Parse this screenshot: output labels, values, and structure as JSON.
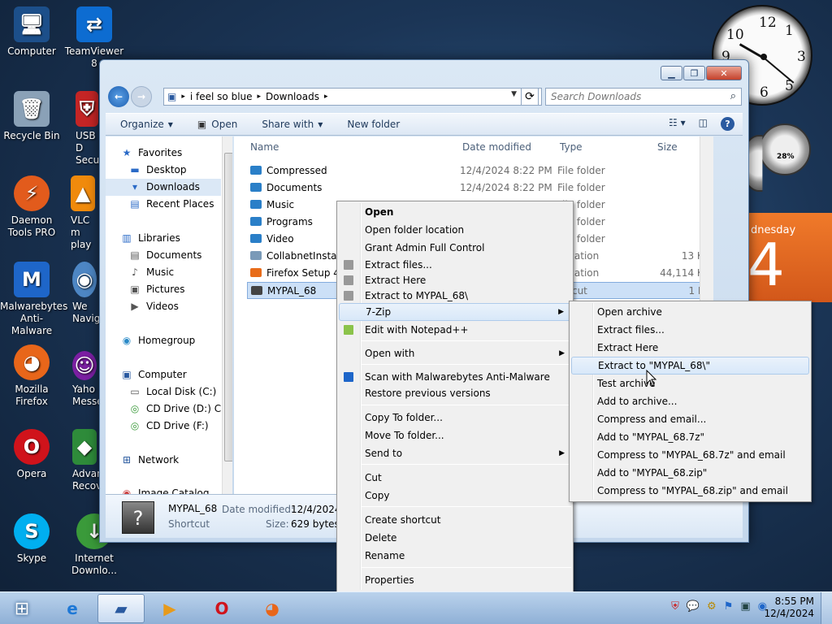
{
  "desktop": {
    "icons": [
      {
        "label": "Computer",
        "glyph": "🖥"
      },
      {
        "label": "TeamViewer 8",
        "glyph": "⇄"
      },
      {
        "label": "Recycle Bin",
        "glyph": "🗑"
      },
      {
        "label": "USB D Secu",
        "glyph": "⛨"
      },
      {
        "label": "Daemon Tools PRO",
        "glyph": "⚡"
      },
      {
        "label": "VLC m play",
        "glyph": "▲"
      },
      {
        "label": "Malwarebytes Anti-Malware",
        "glyph": "M"
      },
      {
        "label": "We Naviga",
        "glyph": "◉"
      },
      {
        "label": "Mozilla Firefox",
        "glyph": "◕"
      },
      {
        "label": "Yaho Messe",
        "glyph": "☺"
      },
      {
        "label": "Opera",
        "glyph": "O"
      },
      {
        "label": "Advanc Recov",
        "glyph": "◆"
      },
      {
        "label": "Skype",
        "glyph": "S"
      },
      {
        "label": "Internet Downlo...",
        "glyph": "↓"
      }
    ],
    "meter_label": "28%",
    "calendar_day": "dnesday",
    "calendar_date": "4"
  },
  "explorer": {
    "breadcrumbs": [
      "i feel so blue",
      "Downloads"
    ],
    "search_placeholder": "Search Downloads",
    "toolbar": {
      "organize": "Organize",
      "open": "Open",
      "share_with": "Share with",
      "new_folder": "New folder"
    },
    "nav": {
      "favorites": "Favorites",
      "desktop": "Desktop",
      "downloads": "Downloads",
      "recent_places": "Recent Places",
      "libraries": "Libraries",
      "documents": "Documents",
      "music": "Music",
      "pictures": "Pictures",
      "videos": "Videos",
      "homegroup": "Homegroup",
      "computer": "Computer",
      "local_disk": "Local Disk (C:)",
      "cd_drive_d": "CD Drive (D:) CDI",
      "cd_drive_f": "CD Drive (F:)",
      "network": "Network",
      "image_catalog": "Image Catalog"
    },
    "columns": {
      "name": "Name",
      "date": "Date modified",
      "type": "Type",
      "size": "Size"
    },
    "files": [
      {
        "name": "Compressed",
        "date": "12/4/2024 8:22 PM",
        "type": "File folder",
        "size": ""
      },
      {
        "name": "Documents",
        "date": "12/4/2024 8:22 PM",
        "type": "File folder",
        "size": ""
      },
      {
        "name": "Music",
        "date": "",
        "type": "File folder",
        "size": ""
      },
      {
        "name": "Programs",
        "date": "",
        "type": "File folder",
        "size": ""
      },
      {
        "name": "Video",
        "date": "",
        "type": "File folder",
        "size": ""
      },
      {
        "name": "CollabnetInstalle",
        "date": "",
        "type": "plication",
        "size": "13 KB"
      },
      {
        "name": "Firefox Setup 48.",
        "date": "",
        "type": "plication",
        "size": "44,114 KB"
      },
      {
        "name": "MYPAL_68",
        "date": "",
        "type": "ortcut",
        "size": "1 KB"
      }
    ],
    "details": {
      "name": "MYPAL_68",
      "date_label": "Date modified:",
      "date_value": "12/4/2024 8",
      "kind": "Shortcut",
      "size_label": "Size:",
      "size_value": "629 bytes"
    }
  },
  "context_menu": {
    "items": [
      "Open",
      "Open folder location",
      "Grant Admin Full Control",
      "Extract files...",
      "Extract Here",
      "Extract to MYPAL_68\\",
      "7-Zip",
      "Edit with Notepad++",
      "Open with",
      "Scan with Malwarebytes Anti-Malware",
      "Restore previous versions",
      "Copy To folder...",
      "Move To folder...",
      "Send to",
      "Cut",
      "Copy",
      "Create shortcut",
      "Delete",
      "Rename",
      "Properties"
    ]
  },
  "zip_menu": {
    "items": [
      "Open archive",
      "Extract files...",
      "Extract Here",
      "Extract to \"MYPAL_68\\\"",
      "Test archive",
      "Add to archive...",
      "Compress and email...",
      "Add to \"MYPAL_68.7z\"",
      "Compress to \"MYPAL_68.7z\" and email",
      "Add to \"MYPAL_68.zip\"",
      "Compress to \"MYPAL_68.zip\" and email"
    ]
  },
  "taskbar": {
    "time": "8:55 PM",
    "date": "12/4/2024"
  },
  "colors": {
    "accent": "#2a7fc8",
    "taskbar": "#a9c3e2",
    "highlight": "#d8e8f9"
  }
}
